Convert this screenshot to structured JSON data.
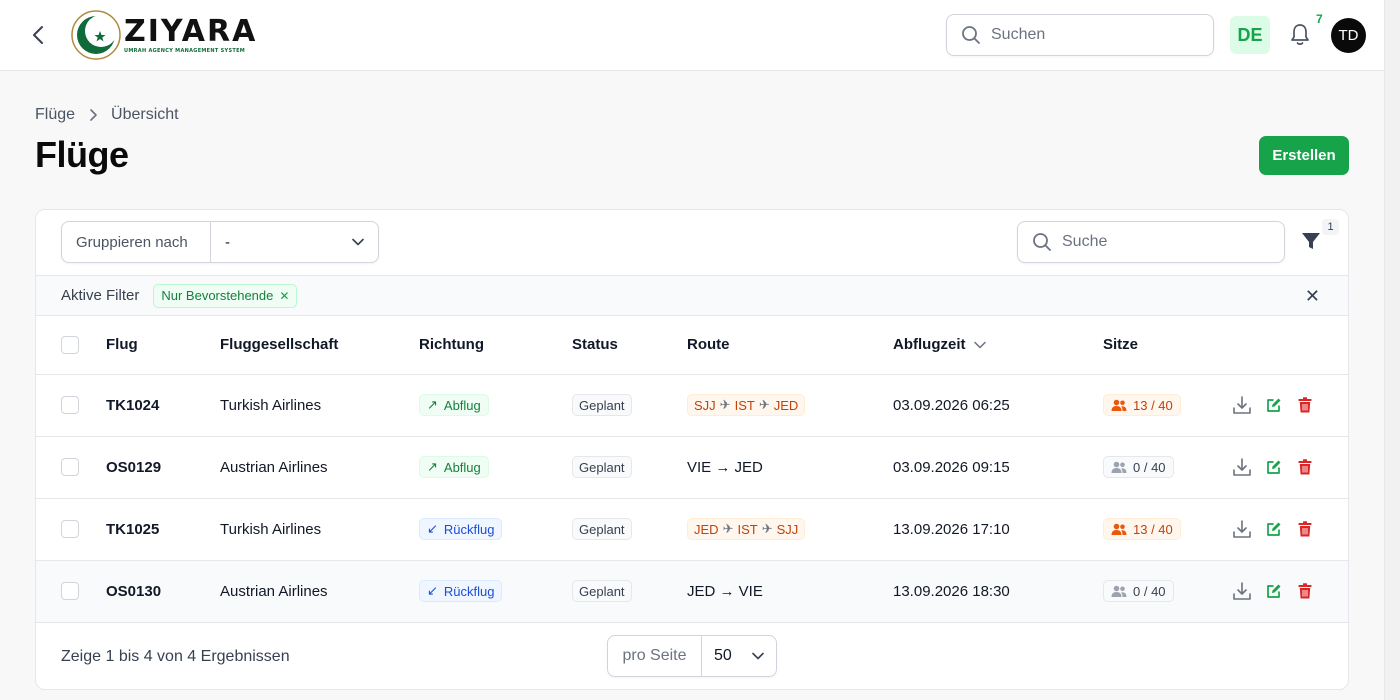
{
  "header": {
    "logo_text": "ZIYARA",
    "logo_subtitle": "UMRAH AGENCY MANAGEMENT SYSTEM",
    "search_placeholder": "Suchen",
    "language": "DE",
    "notification_count": "7",
    "user_initials": "TD"
  },
  "breadcrumb": [
    "Flüge",
    "Übersicht"
  ],
  "page_title": "Flüge",
  "create_label": "Erstellen",
  "toolbar": {
    "group_by_label": "Gruppieren nach",
    "group_by_value": "-",
    "search_placeholder": "Suche",
    "filter_count": "1"
  },
  "active_filters": {
    "label": "Aktive Filter",
    "chips": [
      "Nur Bevorstehende"
    ]
  },
  "table": {
    "columns": [
      "Flug",
      "Fluggesellschaft",
      "Richtung",
      "Status",
      "Route",
      "Abflugzeit",
      "Sitze"
    ],
    "rows": [
      {
        "flight": "TK1024",
        "airline": "Turkish Airlines",
        "direction": "Abflug",
        "status": "Geplant",
        "route": [
          "SJJ",
          "IST",
          "JED"
        ],
        "route_text": "",
        "departure": "03.09.2026 06:25",
        "seats": "13 / 40"
      },
      {
        "flight": "OS0129",
        "airline": "Austrian Airlines",
        "direction": "Abflug",
        "status": "Geplant",
        "route": [],
        "route_text": "VIE → JED",
        "departure": "03.09.2026 09:15",
        "seats": "0 / 40"
      },
      {
        "flight": "TK1025",
        "airline": "Turkish Airlines",
        "direction": "Rückflug",
        "status": "Geplant",
        "route": [
          "JED",
          "IST",
          "SJJ"
        ],
        "route_text": "",
        "departure": "13.09.2026 17:10",
        "seats": "13 / 40"
      },
      {
        "flight": "OS0130",
        "airline": "Austrian Airlines",
        "direction": "Rückflug",
        "status": "Geplant",
        "route": [],
        "route_text": "JED → VIE",
        "departure": "13.09.2026 18:30",
        "seats": "0 / 40"
      }
    ]
  },
  "footer": {
    "summary": "Zeige 1 bis 4 von 4 Ergebnissen",
    "per_page_label": "pro Seite",
    "per_page_value": "50"
  },
  "colors": {
    "brand_green": "#16a34a",
    "danger_red": "#dc2626",
    "route_orange": "#c2410c",
    "return_blue": "#1d4ed8"
  }
}
